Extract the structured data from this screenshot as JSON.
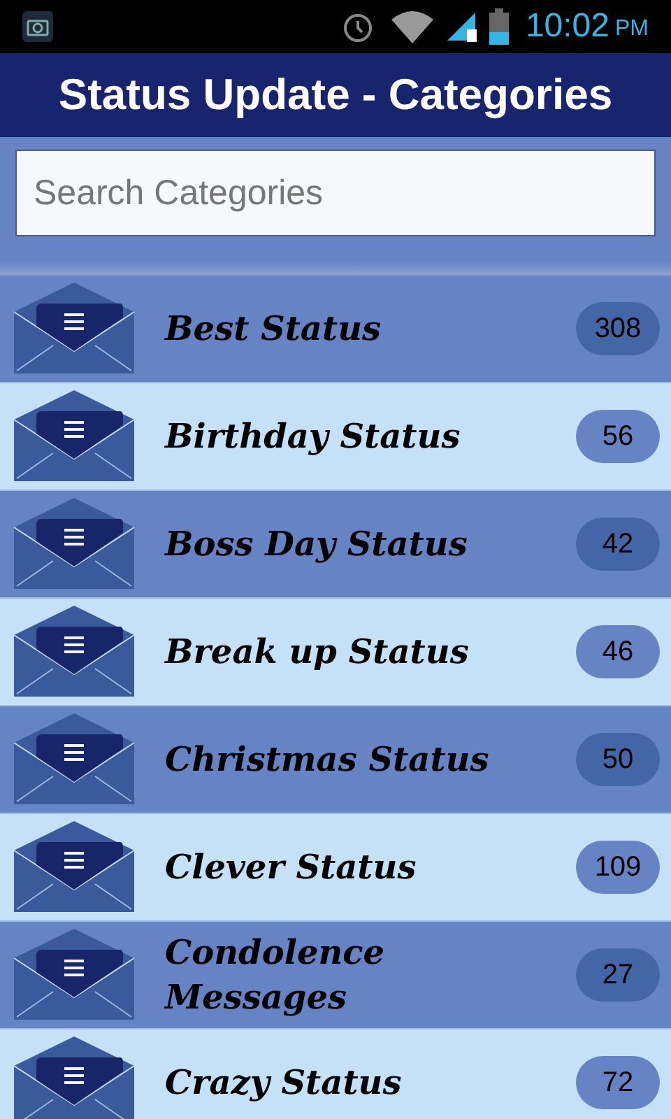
{
  "status_bar": {
    "time": "10:02",
    "period": "PM"
  },
  "title": "Status Update - Categories",
  "search": {
    "placeholder": "Search Categories"
  },
  "categories": [
    {
      "name": "Best Status",
      "count": "308"
    },
    {
      "name": "Birthday Status",
      "count": "56"
    },
    {
      "name": "Boss Day Status",
      "count": "42"
    },
    {
      "name": "Break up Status",
      "count": "46"
    },
    {
      "name": "Christmas Status",
      "count": "50"
    },
    {
      "name": "Clever Status",
      "count": "109"
    },
    {
      "name": "Condolence Messages",
      "count": "27"
    },
    {
      "name": "Crazy Status",
      "count": "72"
    }
  ]
}
